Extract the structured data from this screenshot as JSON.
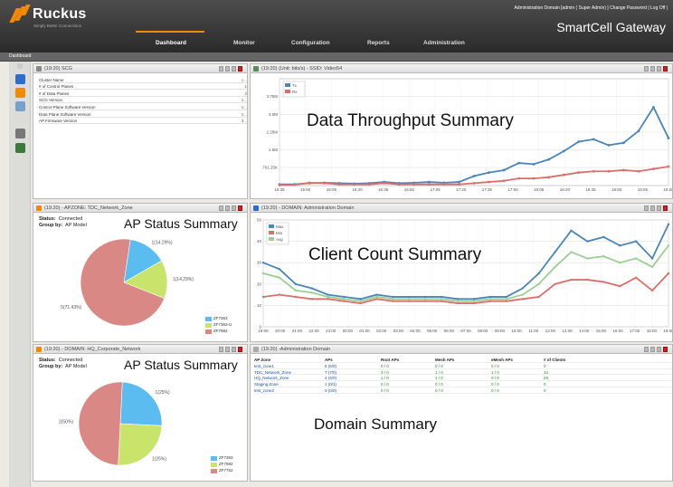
{
  "header": {
    "brand_name": "Ruckus",
    "brand_tagline": "Simply Better Connections",
    "top_links": "Administration Domain [admin ( Super Admin) ]  Change Password | Log Off |",
    "product_title": "SmartCell Gateway",
    "subbar_label": "Dashboard"
  },
  "nav": {
    "items": [
      {
        "label": "Dashboard",
        "active": true
      },
      {
        "label": "Monitor",
        "active": false
      },
      {
        "label": "Configuration",
        "active": false
      },
      {
        "label": "Reports",
        "active": false
      },
      {
        "label": "Administration",
        "active": false
      }
    ]
  },
  "colors": {
    "accent": "#f08a00",
    "header_bg": "#2f2f2f",
    "tx_line": "#4a86b8",
    "rx_line": "#d9706c",
    "max_line": "#4a86b8",
    "min_line": "#d9706c",
    "avg_line": "#9ccf94"
  },
  "scg_panel": {
    "title": "(19:20) SCG",
    "rows": [
      {
        "label": "Cluster Name",
        "value": "c..."
      },
      {
        "label": "# of Control Planes",
        "value": "1"
      },
      {
        "label": "# of Data Planes",
        "value": "2"
      },
      {
        "label": "SCG Version",
        "value": "1..."
      },
      {
        "label": "Control Plane Software Version",
        "value": "1..."
      },
      {
        "label": "Data Plane Software Version",
        "value": "1..."
      },
      {
        "label": "AP Firmware Version",
        "value": "3..."
      }
    ]
  },
  "throughput_panel": {
    "title": "(19:20)  (Unit: bits/s) - SSID: Video54",
    "overlay_label": "Data Throughput Summary"
  },
  "ap_status_1": {
    "title": "(19:20) - APZONE: TDC_Network_Zone",
    "status_label": "Status:",
    "status_value": "Connected",
    "group_label": "Group by:",
    "group_value": "AP Model",
    "overlay_label": "AP Status Summary"
  },
  "client_panel": {
    "title": "(19:20) - DOMAIN: Administration Domain",
    "overlay_label": "Client Count Summary"
  },
  "ap_status_2": {
    "title": "(19:20) - DOMAIN: HQ_Corporate_Network",
    "status_label": "Status:",
    "status_value": "Connected",
    "group_label": "Group by:",
    "group_value": "AP Model",
    "overlay_label": "AP Status Summary"
  },
  "domain_panel": {
    "title": "(19:20) -Administration Domain",
    "overlay_label": "Domain Summary",
    "columns": [
      "AP Zone",
      "APs",
      "Root APs",
      "Mesh APs",
      "eMesh APs",
      "# of Clients"
    ],
    "rows": [
      [
        "test_zone1",
        "5 (5/0)",
        "0 / 0",
        "0 / 0",
        "0 / 0",
        "0"
      ],
      [
        "TDC_Network_Zone",
        "7 (7/0)",
        "3 / 0",
        "1 / 0",
        "1 / 0",
        "34"
      ],
      [
        "HQ_Network_Zone",
        "4 (4/0)",
        "1 / 0",
        "1 / 0",
        "0 / 0",
        "29"
      ],
      [
        "Staging Zone",
        "1 (0/1)",
        "0 / 0",
        "0 / 0",
        "0 / 0",
        "0"
      ],
      [
        "test_zone2",
        "0 (0/0)",
        "0 / 0",
        "0 / 0",
        "0 / 0",
        "0"
      ]
    ]
  },
  "chart_data": [
    {
      "type": "line",
      "title": "",
      "ylim": [
        0,
        4.5
      ],
      "yticks": [
        "761.25K",
        "1.5M",
        "2.25M",
        "3.0M",
        "3.75M"
      ],
      "ytick_values": [
        0.76,
        1.5,
        2.25,
        3.0,
        3.75
      ],
      "categories": [
        "15:35",
        "15:50",
        "16:05",
        "16:20",
        "16:35",
        "16:50",
        "17:05",
        "17:20",
        "17:35",
        "17:50",
        "18:05",
        "18:20",
        "18:35",
        "18:50",
        "19:05",
        "19:20"
      ],
      "series": [
        {
          "name": "Tx",
          "values": [
            0.05,
            0.05,
            0.1,
            0.12,
            0.1,
            0.08,
            0.1,
            0.15,
            0.1,
            0.12,
            0.15,
            0.12,
            0.15,
            0.4,
            0.55,
            0.65,
            0.95,
            0.9,
            1.1,
            1.45,
            1.85,
            1.95,
            1.7,
            1.8,
            2.3,
            3.3,
            2.0
          ]
        },
        {
          "name": "Rx",
          "values": [
            0.02,
            0.03,
            0.12,
            0.1,
            0.05,
            0.05,
            0.05,
            0.1,
            0.05,
            0.05,
            0.05,
            0.05,
            0.05,
            0.1,
            0.15,
            0.2,
            0.3,
            0.3,
            0.35,
            0.45,
            0.55,
            0.6,
            0.6,
            0.65,
            0.6,
            0.7,
            0.8
          ]
        }
      ],
      "legend": "top-left"
    },
    {
      "type": "pie",
      "categories": [
        "ZF7363",
        "ZF7363-U",
        "ZF7982"
      ],
      "values": [
        14.29,
        14.29,
        71.43
      ],
      "labels": [
        "1(14.29%)",
        "1(14.29%)",
        "5(71.43%)"
      ],
      "legend": "bottom-right"
    },
    {
      "type": "line",
      "ylim": [
        0,
        50
      ],
      "yticks": [
        "0",
        "10",
        "20",
        "30",
        "40",
        "50"
      ],
      "categories": [
        "19:00",
        "20:00",
        "21:00",
        "22:00",
        "23:00",
        "00:00",
        "01:00",
        "02:00",
        "03:00",
        "04:00",
        "05:00",
        "06:00",
        "07:00",
        "08:00",
        "09:00",
        "10:00",
        "11:00",
        "12:00",
        "13:00",
        "14:00",
        "15:00",
        "16:00",
        "17:00",
        "18:00",
        "19:00"
      ],
      "series": [
        {
          "name": "Max",
          "values": [
            30,
            27,
            20,
            18,
            15,
            14,
            13,
            15,
            14,
            14,
            14,
            14,
            13,
            13,
            14,
            14,
            18,
            25,
            35,
            45,
            40,
            42,
            38,
            40,
            32,
            48
          ]
        },
        {
          "name": "Min",
          "values": [
            14,
            15,
            14,
            13,
            13,
            12,
            11,
            13,
            12,
            12,
            12,
            12,
            11,
            11,
            12,
            12,
            13,
            14,
            20,
            22,
            22,
            21,
            19,
            23,
            17,
            25
          ]
        },
        {
          "name": "Avg",
          "values": [
            25,
            23,
            17,
            16,
            14,
            13,
            12,
            14,
            13,
            13,
            13,
            13,
            12,
            12,
            13,
            13,
            15,
            20,
            28,
            35,
            32,
            33,
            30,
            32,
            28,
            38
          ]
        }
      ],
      "legend": "top-left"
    },
    {
      "type": "pie",
      "categories": [
        "ZF7363",
        "ZF7982",
        "ZF7762"
      ],
      "values": [
        25,
        25,
        50
      ],
      "labels": [
        "1(25%)",
        "1(25%)",
        "2(50%)"
      ],
      "legend": "bottom-right"
    }
  ]
}
